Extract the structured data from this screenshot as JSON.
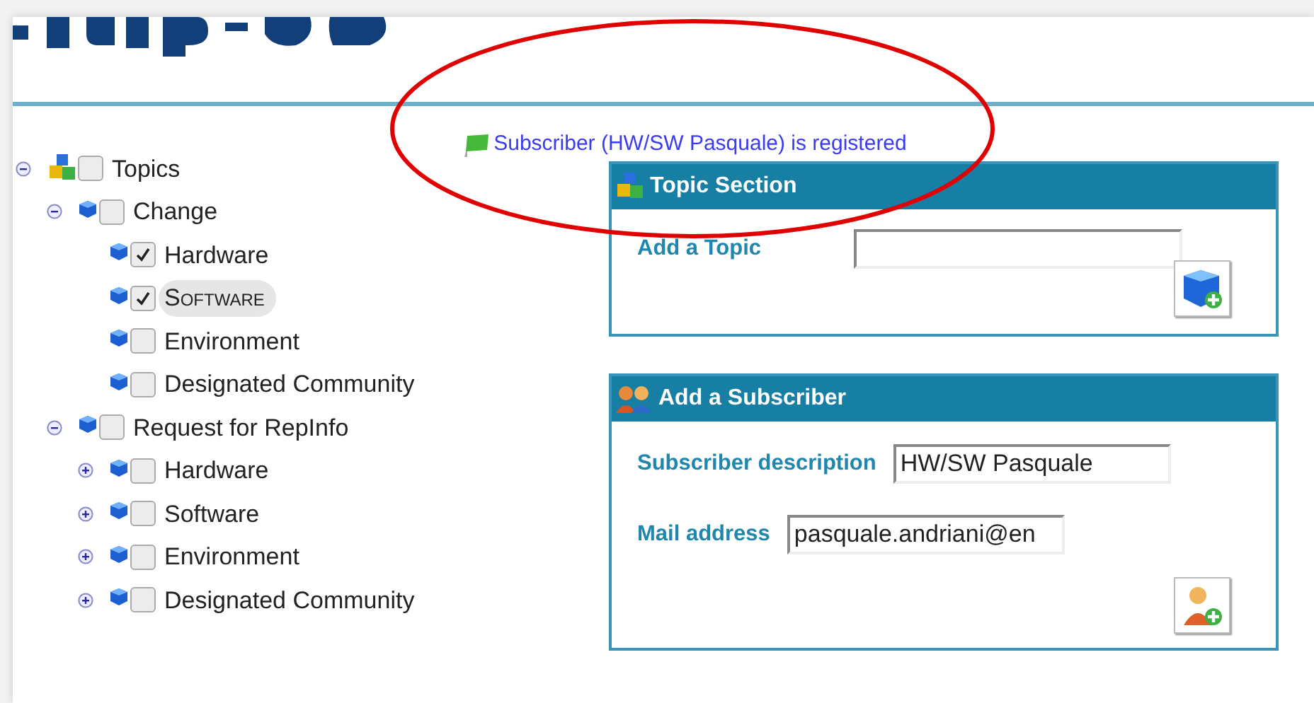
{
  "message": {
    "text": "Subscriber (HW/SW Pasquale) is registered"
  },
  "tree": [
    {
      "label": "Topics",
      "kind": "root",
      "checked": false,
      "expanded": true,
      "highlighted": false,
      "children": [
        {
          "label": "Change",
          "kind": "topic",
          "checked": false,
          "expanded": true,
          "highlighted": false,
          "children": [
            {
              "label": "Hardware",
              "kind": "topic",
              "checked": true,
              "highlighted": false
            },
            {
              "label": "Software",
              "kind": "topic",
              "checked": true,
              "highlighted": true
            },
            {
              "label": "Environment",
              "kind": "topic",
              "checked": false,
              "highlighted": false
            },
            {
              "label": "Designated Community",
              "kind": "topic",
              "checked": false,
              "highlighted": false
            }
          ]
        },
        {
          "label": "Request for RepInfo",
          "kind": "topic",
          "checked": false,
          "expanded": true,
          "highlighted": false,
          "children": [
            {
              "label": "Hardware",
              "kind": "topic",
              "checked": false,
              "expanded": false,
              "highlighted": false
            },
            {
              "label": "Software",
              "kind": "topic",
              "checked": false,
              "expanded": false,
              "highlighted": false
            },
            {
              "label": "Environment",
              "kind": "topic",
              "checked": false,
              "expanded": false,
              "highlighted": false
            },
            {
              "label": "Designated Community",
              "kind": "topic",
              "checked": false,
              "expanded": false,
              "highlighted": false
            }
          ]
        }
      ]
    }
  ],
  "panels": [
    {
      "title": "Topic Section",
      "kind": "topic",
      "fields": [
        {
          "label": "Add a Topic"
        }
      ]
    },
    {
      "title": "Add a Subscriber",
      "kind": "subscriber",
      "fields": [
        {
          "label": "Subscriber description",
          "value": "HW/SW Pasquale"
        },
        {
          "label": "Mail address",
          "value": "pasquale.andriani@en"
        }
      ]
    }
  ]
}
